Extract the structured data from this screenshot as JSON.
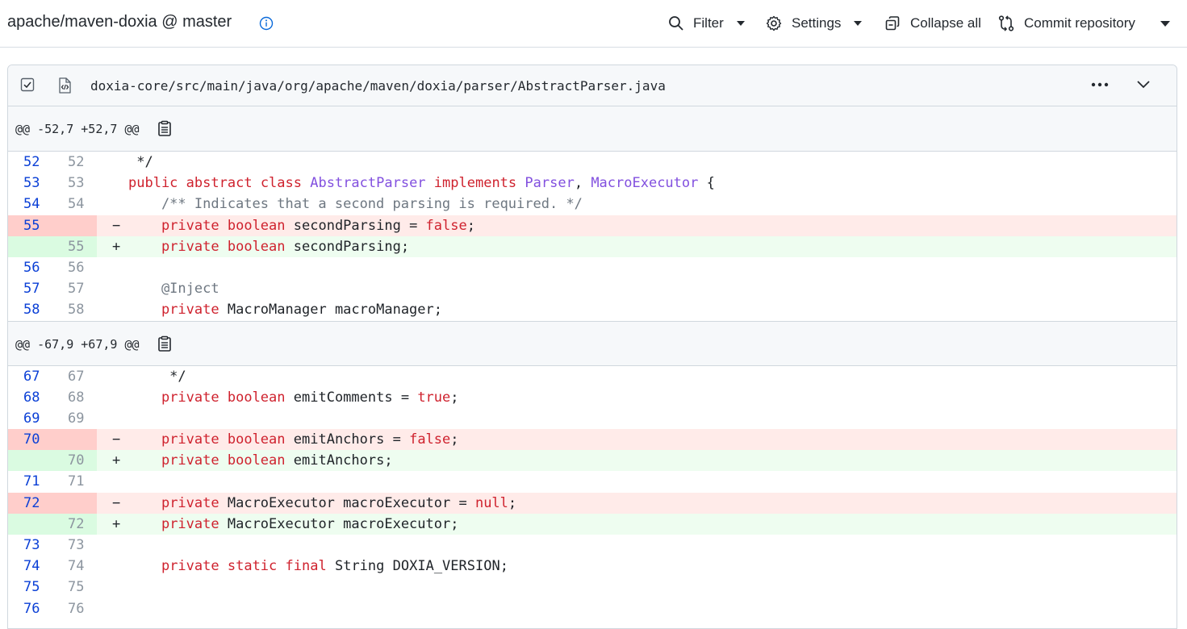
{
  "header": {
    "repo_title": "apache/maven-doxia @ master",
    "filter_label": "Filter",
    "settings_label": "Settings",
    "collapse_label": "Collapse all",
    "commit_label": "Commit repository"
  },
  "file": {
    "path": "doxia-core/src/main/java/org/apache/maven/doxia/parser/AbstractParser.java"
  },
  "hunks": [
    {
      "header": "@@ -52,7 +52,7 @@",
      "rows": [
        {
          "type": "ctx",
          "old": "52",
          "new": "52",
          "text": " */"
        },
        {
          "type": "ctx",
          "old": "53",
          "new": "53",
          "text": "public abstract class AbstractParser implements Parser, MacroExecutor {"
        },
        {
          "type": "ctx",
          "old": "54",
          "new": "54",
          "text": "    /** Indicates that a second parsing is required. */"
        },
        {
          "type": "del",
          "old": "55",
          "new": "",
          "text": "    private boolean secondParsing = false;"
        },
        {
          "type": "add",
          "old": "",
          "new": "55",
          "text": "    private boolean secondParsing;"
        },
        {
          "type": "ctx",
          "old": "56",
          "new": "56",
          "text": ""
        },
        {
          "type": "ctx",
          "old": "57",
          "new": "57",
          "text": "    @Inject"
        },
        {
          "type": "ctx",
          "old": "58",
          "new": "58",
          "text": "    private MacroManager macroManager;"
        }
      ]
    },
    {
      "header": "@@ -67,9 +67,9 @@",
      "rows": [
        {
          "type": "ctx",
          "old": "67",
          "new": "67",
          "text": "     */"
        },
        {
          "type": "ctx",
          "old": "68",
          "new": "68",
          "text": "    private boolean emitComments = true;"
        },
        {
          "type": "ctx",
          "old": "69",
          "new": "69",
          "text": ""
        },
        {
          "type": "del",
          "old": "70",
          "new": "",
          "text": "    private boolean emitAnchors = false;"
        },
        {
          "type": "add",
          "old": "",
          "new": "70",
          "text": "    private boolean emitAnchors;"
        },
        {
          "type": "ctx",
          "old": "71",
          "new": "71",
          "text": ""
        },
        {
          "type": "del",
          "old": "72",
          "new": "",
          "text": "    private MacroExecutor macroExecutor = null;"
        },
        {
          "type": "add",
          "old": "",
          "new": "72",
          "text": "    private MacroExecutor macroExecutor;"
        },
        {
          "type": "ctx",
          "old": "73",
          "new": "73",
          "text": ""
        },
        {
          "type": "ctx",
          "old": "74",
          "new": "74",
          "text": "    private static final String DOXIA_VERSION;"
        },
        {
          "type": "ctx",
          "old": "75",
          "new": "75",
          "text": ""
        },
        {
          "type": "ctx",
          "old": "76",
          "new": "76",
          "text": ""
        }
      ]
    }
  ],
  "markers": {
    "del": "−",
    "add": "+"
  },
  "colors": {
    "deleted_bg": "#ffebe9",
    "added_bg": "#eefdf0",
    "keyword": "#cf222e",
    "type": "#8250df",
    "comment": "#6e7781"
  }
}
